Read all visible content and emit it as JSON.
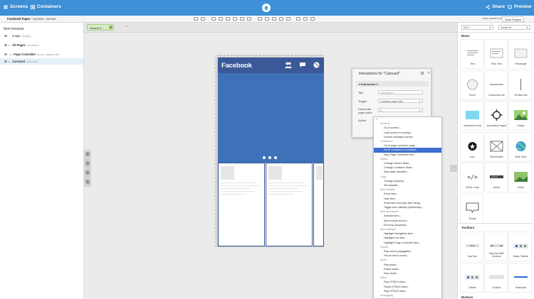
{
  "topbar": {
    "nav": [
      {
        "label": "Screens"
      },
      {
        "label": "Containers"
      }
    ],
    "actions": [
      {
        "label": "Share"
      },
      {
        "label": "Preview"
      }
    ]
  },
  "subbar": {
    "breadcrumb": {
      "project": "Facebook Paper",
      "sep1": "›",
      "section": "Screens",
      "sep2": "›",
      "screen": "Screen"
    },
    "autosave": {
      "label": "Auto saved in",
      "value": "< 1 minutes"
    },
    "save_button": "Save Project"
  },
  "item_browser": {
    "title": "Item browser",
    "items": [
      {
        "label": "Image",
        "note": "(image)"
      },
      {
        "label": "All Pages",
        "note": "(container)"
      },
      {
        "label": "Page Controller",
        "note": "(scroll_pages/main)"
      },
      {
        "label": "Carousel",
        "note": "(carousel)"
      }
    ]
  },
  "canvas": {
    "screen_tab": "Default S...",
    "phone": {
      "app_title": "Facebook"
    }
  },
  "interactions": {
    "title": "Interactions for \"Carousel\"",
    "section": "Interaction 0",
    "fields": [
      {
        "label": "Title",
        "value": "Interaction 0"
      },
      {
        "label": "Trigger",
        "value": "Container page enter"
      },
      {
        "label": "Horizontal page index",
        "value": "0"
      },
      {
        "label": "Action",
        "value": ""
      }
    ]
  },
  "action_menu": {
    "items": [
      {
        "label": "✓",
        "type": "check"
      },
      {
        "label": "Screens",
        "type": "header"
      },
      {
        "label": "Go to screen...",
        "type": "item"
      },
      {
        "label": "Load screen to overlay...",
        "type": "item"
      },
      {
        "label": "Unload overlayed screen",
        "type": "item"
      },
      {
        "label": "Containers",
        "type": "header"
      },
      {
        "label": "Go to page container page...",
        "type": "item"
      },
      {
        "label": "Scroll container to container...",
        "type": "highlight"
      },
      {
        "label": "Stop Page Controller item...",
        "type": "item"
      },
      {
        "label": "States",
        "type": "header"
      },
      {
        "label": "Change Screen State...",
        "type": "item"
      },
      {
        "label": "Change Container State...",
        "type": "item"
      },
      {
        "label": "Stop state transition...",
        "type": "item"
      },
      {
        "label": "Logic",
        "type": "header"
      },
      {
        "label": "Change property...",
        "type": "item"
      },
      {
        "label": "Set variable...",
        "type": "item"
      },
      {
        "label": "Item visibility",
        "type": "header"
      },
      {
        "label": "Show item...",
        "type": "item"
      },
      {
        "label": "Hide item...",
        "type": "item"
      },
      {
        "label": "Show item and hide after delay...",
        "type": "item"
      },
      {
        "label": "Toggle item visibility (hide/show)...",
        "type": "item"
      },
      {
        "label": "Item animations",
        "type": "header"
      },
      {
        "label": "Animate item...",
        "type": "item"
      },
      {
        "label": "Move whole screen...",
        "type": "item"
      },
      {
        "label": "End loop sequence...",
        "type": "item"
      },
      {
        "label": "Item highlight",
        "type": "header"
      },
      {
        "label": "Highlight Navigation item...",
        "type": "item"
      },
      {
        "label": "Highlight List item...",
        "type": "item"
      },
      {
        "label": "Highlight Page Controller item...",
        "type": "item"
      },
      {
        "label": "Events",
        "type": "header"
      },
      {
        "label": "Stop event propagation",
        "type": "item"
      },
      {
        "label": "Fire an item's event...",
        "type": "item"
      },
      {
        "label": "Audio",
        "type": "header"
      },
      {
        "label": "Play audio...",
        "type": "item"
      },
      {
        "label": "Pause audio...",
        "type": "item"
      },
      {
        "label": "Stop audio...",
        "type": "item"
      },
      {
        "label": "Video",
        "type": "header"
      },
      {
        "label": "Play HTML5 video...",
        "type": "item"
      },
      {
        "label": "Pause HTML5 video...",
        "type": "item"
      },
      {
        "label": "Stop HTML5 video...",
        "type": "item"
      },
      {
        "label": "Debugging",
        "type": "header"
      }
    ]
  },
  "right_panel": {
    "platform_select": "iOS 7",
    "theme_select": "Jumbo bl...",
    "basic_title": "Basic",
    "basic_widgets": [
      {
        "label": "Text",
        "icon": "text-icon"
      },
      {
        "label": "Rich Text",
        "icon": "rich-text-icon"
      },
      {
        "label": "Rectangle",
        "icon": "rectangle-icon"
      },
      {
        "label": "Circle",
        "icon": "circle-icon"
      },
      {
        "label": "Horizontal line",
        "icon": "horizontal-line-icon"
      },
      {
        "label": "Vertical line",
        "icon": "vertical-line-icon"
      },
      {
        "label": "Interaction Area",
        "icon": "interaction-area-icon"
      },
      {
        "label": "Annotation target",
        "icon": "annotation-target-icon"
      },
      {
        "label": "Image",
        "icon": "image-icon"
      },
      {
        "label": "Icon",
        "icon": "star-icon"
      },
      {
        "label": "Placeholder",
        "icon": "placeholder-icon"
      },
      {
        "label": "Web View",
        "icon": "globe-icon"
      },
      {
        "label": "HTML Code",
        "icon": "code-icon"
      },
      {
        "label": "Audio",
        "icon": "audio-icon"
      },
      {
        "label": "Video",
        "icon": "video-icon"
      },
      {
        "label": "Tooltip",
        "icon": "tooltip-icon"
      }
    ],
    "toolbars_title": "Toolbars",
    "toolbar_widgets": [
      {
        "label": "Nav Bar",
        "icon": "nav-bar-icon"
      },
      {
        "label": "Nav Bar With Buttons",
        "icon": "nav-bar-buttons-icon"
      },
      {
        "label": "Basic Tabbar",
        "icon": "tabbar-icon"
      },
      {
        "label": "Tabbar",
        "icon": "tabbar-icon"
      },
      {
        "label": "Toolbar",
        "icon": "toolbar-icon"
      },
      {
        "label": "Statusbar",
        "icon": "statusbar-icon"
      }
    ],
    "buttons_title": "Buttons"
  },
  "colors": {
    "topbar": "#3d8fd6",
    "facebook_blue": "#3b5998",
    "menu_highlight": "#3f6ecf"
  }
}
